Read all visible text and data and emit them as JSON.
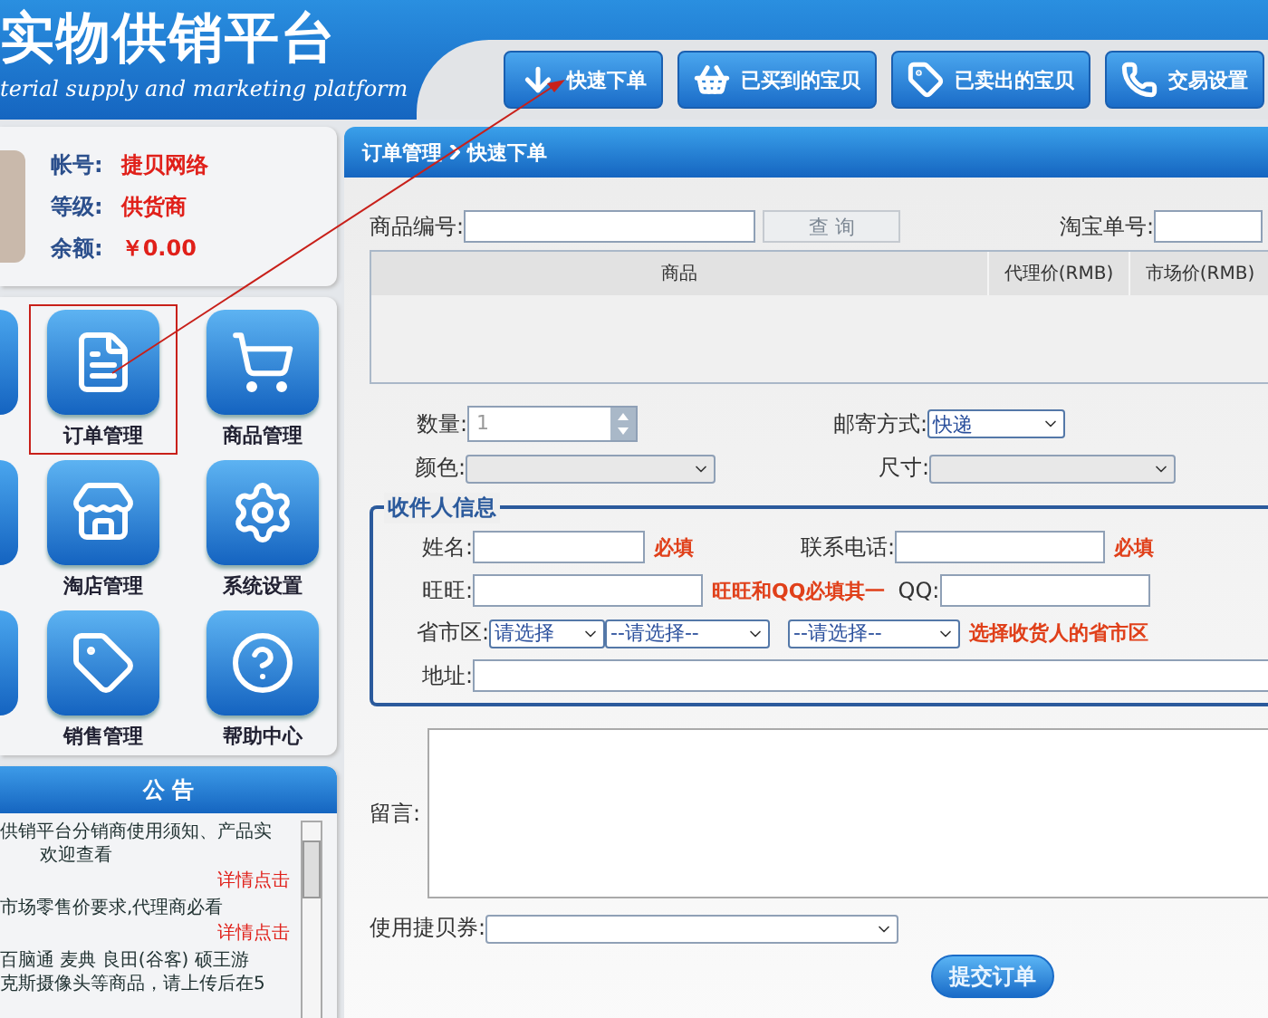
{
  "header": {
    "title": "实物供销平台",
    "subtitle": "terial supply and marketing platform",
    "nav_buttons": [
      {
        "label": "快速下单"
      },
      {
        "label": "已买到的宝贝"
      },
      {
        "label": "已卖出的宝贝"
      },
      {
        "label": "交易设置"
      }
    ]
  },
  "account": [
    {
      "label": "帐号:",
      "value": "捷贝网络"
    },
    {
      "label": "等级:",
      "value": "供货商"
    },
    {
      "label": "余额:",
      "value": "￥0.00"
    }
  ],
  "modules": [
    {
      "label": "订单管理",
      "highlighted": true
    },
    {
      "label": "商品管理",
      "highlighted": false
    },
    {
      "label": "淘店管理",
      "highlighted": false
    },
    {
      "label": "系统设置",
      "highlighted": false
    },
    {
      "label": "销售管理",
      "highlighted": false
    },
    {
      "label": "帮助中心",
      "highlighted": false
    }
  ],
  "notice": {
    "title": "公 告",
    "items": [
      {
        "lines": [
          "供销平台分销商使用须知、产品实",
          "欢迎查看"
        ],
        "link": "详情点击"
      },
      {
        "lines": [
          "市场零售价要求,代理商必看"
        ],
        "link": "详情点击"
      },
      {
        "lines": [
          "百脑通  麦典  良田(谷客)  硕王游",
          "克斯摄像头等商品，请上传后在5"
        ]
      }
    ]
  },
  "breadcrumb": [
    "订单管理",
    "快速下单"
  ],
  "search": {
    "label": "商品编号:",
    "button": "查  询",
    "button_disabled": true,
    "taobao_label": "淘宝单号:"
  },
  "table": {
    "columns": [
      "商品",
      "代理价(RMB)",
      "市场价(RMB)"
    ]
  },
  "quantity": {
    "label": "数量:",
    "value": "1"
  },
  "shipping": {
    "label": "邮寄方式:",
    "value": "快递"
  },
  "color": {
    "label": "颜色:"
  },
  "size": {
    "label": "尺寸:"
  },
  "recipient": {
    "legend": "收件人信息",
    "name_label": "姓名:",
    "name_hint": "必填",
    "phone_label": "联系电话:",
    "phone_hint": "必填",
    "wangwang_label": "旺旺:",
    "wangwang_hint": "旺旺和QQ必填其一",
    "qq_label": "QQ:",
    "region_label": "省市区:",
    "regions": [
      "请选择",
      "--请选择--",
      "--请选择--"
    ],
    "region_hint": "选择收货人的省市区",
    "address_label": "地址:"
  },
  "message": {
    "label": "留言:"
  },
  "coupon": {
    "label": "使用捷贝券:"
  },
  "submit": "提交订单"
}
